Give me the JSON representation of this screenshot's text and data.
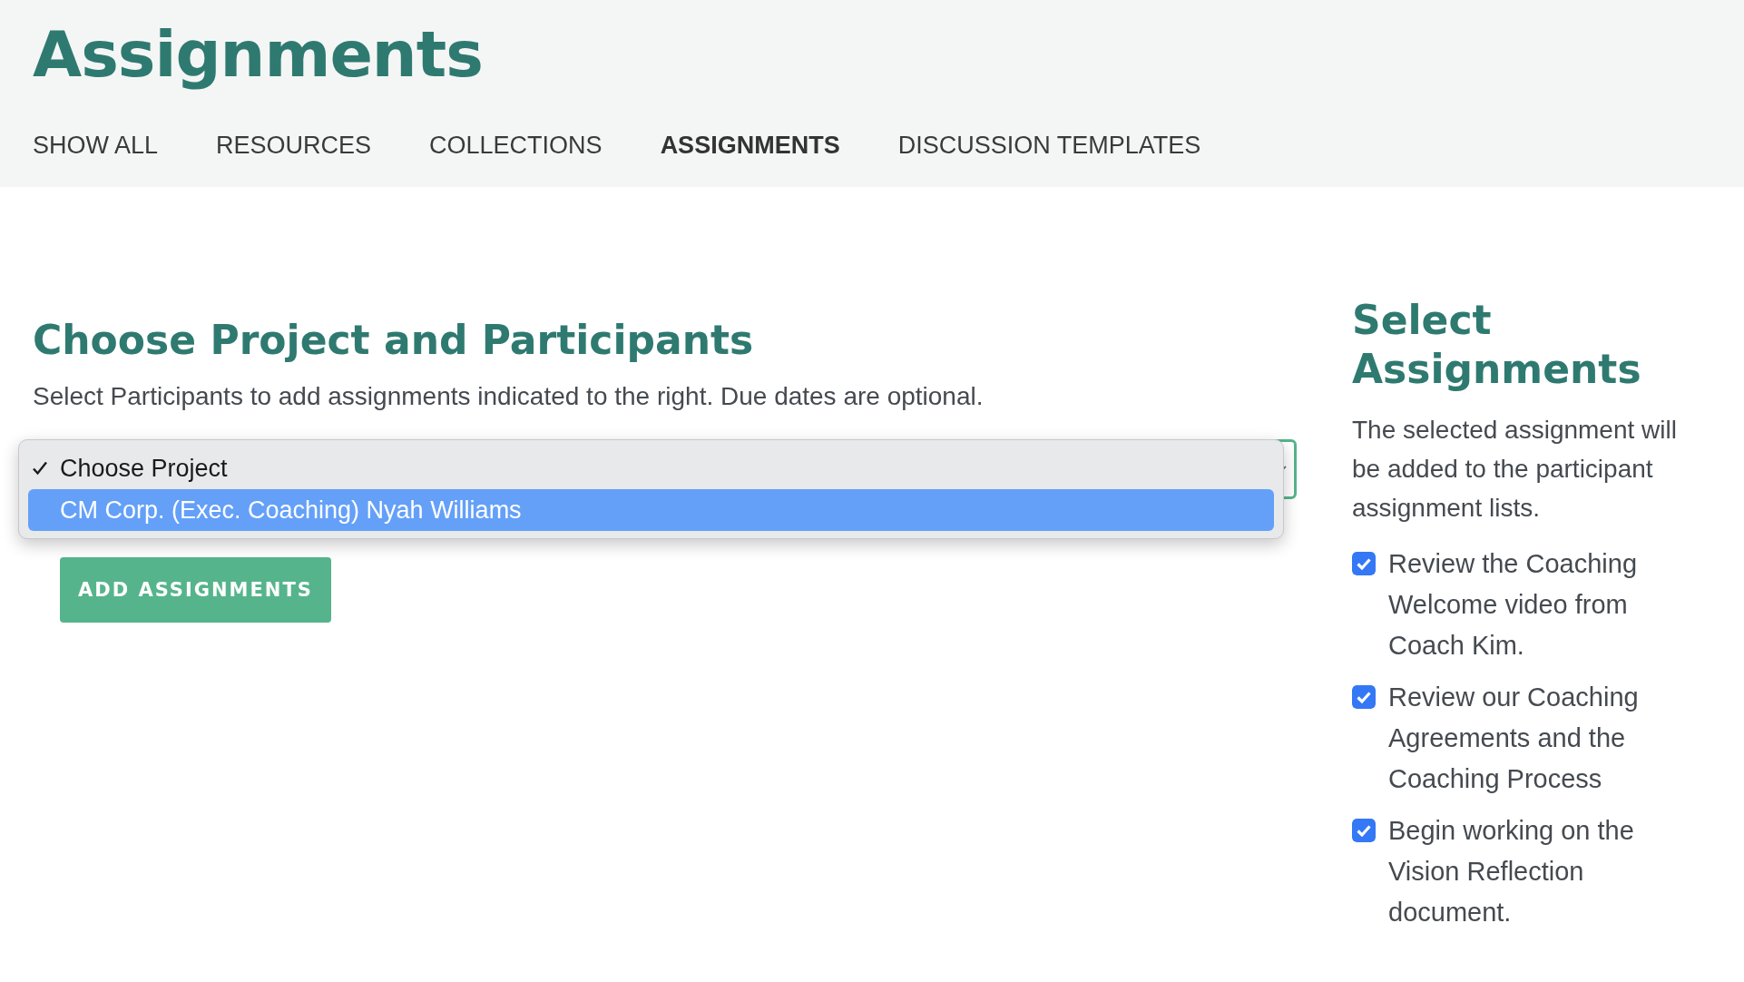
{
  "page_title": "Assignments",
  "tabs": [
    {
      "label": "SHOW ALL",
      "selected": false
    },
    {
      "label": "RESOURCES",
      "selected": false
    },
    {
      "label": "COLLECTIONS",
      "selected": false
    },
    {
      "label": "ASSIGNMENTS",
      "selected": true
    },
    {
      "label": "DISCUSSION TEMPLATES",
      "selected": false
    }
  ],
  "project_section": {
    "title": "Choose Project and Participants",
    "description": "Select Participants to add assignments indicated to the right. Due dates are optional.",
    "project_dropdown": {
      "options": [
        {
          "label": "Choose Project",
          "selected": true,
          "highlighted": false
        },
        {
          "label": "CM Corp. (Exec. Coaching) Nyah Williams",
          "selected": false,
          "highlighted": true
        }
      ]
    },
    "button": "ADD ASSIGNMENTS"
  },
  "assignments_section": {
    "title": "Select Assignments",
    "description": "The selected assignment will be added to the participant assignment lists.",
    "assignments": [
      {
        "label": "Review the Coaching Welcome video from Coach Kim.",
        "checked": true
      },
      {
        "label": "Review our Coaching Agreements and the Coaching Process",
        "checked": true
      },
      {
        "label": "Begin working on the Vision Reflection document.",
        "checked": true
      }
    ]
  }
}
